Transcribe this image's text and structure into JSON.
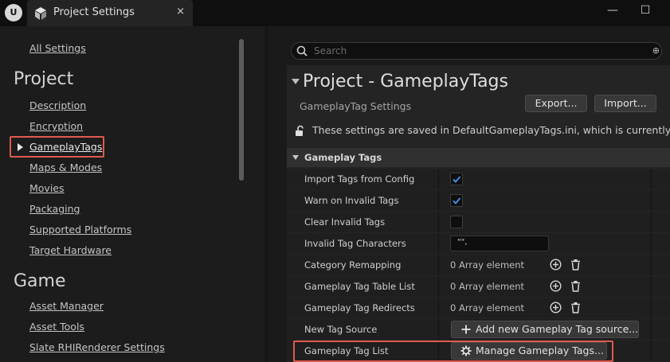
{
  "window": {
    "tab_title": "Project Settings",
    "tab_close": "×",
    "minimize": "—",
    "maximize": "☐",
    "logo": "U"
  },
  "sidebar": {
    "all_settings": "All Settings",
    "project_heading": "Project",
    "project_items": [
      "Description",
      "Encryption",
      "GameplayTags",
      "Maps & Modes",
      "Movies",
      "Packaging",
      "Supported Platforms",
      "Target Hardware"
    ],
    "selected_item": "GameplayTags",
    "game_heading": "Game",
    "game_items": [
      "Asset Manager",
      "Asset Tools",
      "Slate RHIRenderer Settings"
    ]
  },
  "search": {
    "placeholder": "Search"
  },
  "main": {
    "title": "Project - GameplayTags",
    "subtitle": "GameplayTag Settings",
    "export_label": "Export...",
    "import_label": "Import...",
    "notice": "These settings are saved in DefaultGameplayTags.ini, which is currently writa",
    "section_title": "Gameplay Tags",
    "rows": [
      {
        "label": "Import Tags from Config",
        "type": "checkbox",
        "checked": true
      },
      {
        "label": "Warn on Invalid Tags",
        "type": "checkbox",
        "checked": true
      },
      {
        "label": "Clear Invalid Tags",
        "type": "checkbox",
        "checked": false
      },
      {
        "label": "Invalid Tag Characters",
        "type": "text",
        "value": "\",",
        "display": "\"\","
      },
      {
        "label": "Category Remapping",
        "type": "array",
        "value": "0 Array element"
      },
      {
        "label": "Gameplay Tag Table List",
        "type": "array",
        "value": "0 Array element"
      },
      {
        "label": "Gameplay Tag Redirects",
        "type": "array",
        "value": "0 Array element"
      },
      {
        "label": "New Tag Source",
        "type": "button",
        "value": "Add new Gameplay Tag source..."
      },
      {
        "label": "Gameplay Tag List",
        "type": "button",
        "value": "Manage Gameplay Tags..."
      }
    ]
  },
  "colors": {
    "highlight": "#e05a4e",
    "checkbox_accent": "#3d8fe0"
  }
}
